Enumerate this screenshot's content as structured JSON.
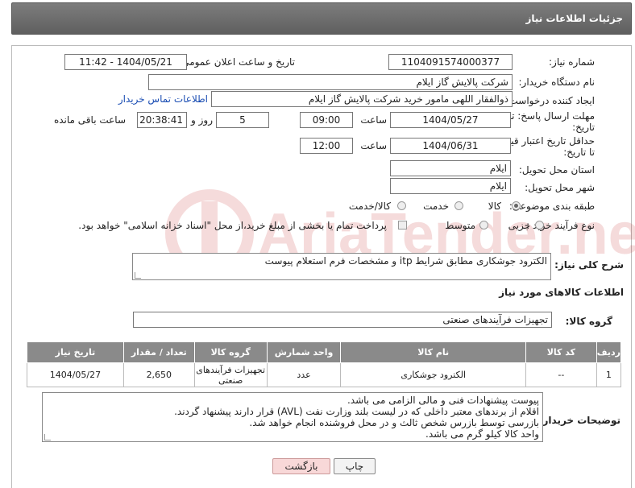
{
  "header": {
    "title": "جزئیات اطلاعات نیاز"
  },
  "form": {
    "need_number_label": "شماره نیاز:",
    "need_number": "1104091574000377",
    "announce_label": "تاریخ و ساعت اعلان عمومی:",
    "announce_value": "1404/05/21 - 11:42",
    "buyer_org_label": "نام دستگاه خریدار:",
    "buyer_org": "شرکت پالایش گاز ایلام",
    "creator_label": "ایجاد کننده درخواست:",
    "creator": "ذوالفقار اللهی مامور خرید شرکت پالایش گاز ایلام",
    "contact_link": "اطلاعات تماس خریدار",
    "reply_deadline_label_1": "مهلت ارسال پاسخ: تا",
    "reply_deadline_label_2": "تاریخ:",
    "reply_date": "1404/05/27",
    "time_label": "ساعت",
    "reply_time": "09:00",
    "days_value": "5",
    "days_label": "روز و",
    "remaining_time": "20:38:41",
    "remaining_label": "ساعت باقی مانده",
    "price_deadline_label_1": "حداقل تاریخ اعتبار قیمت:",
    "price_deadline_label_2": "تا تاریخ:",
    "price_date": "1404/06/31",
    "price_time": "12:00",
    "province_label": "استان محل تحویل:",
    "province": "ایلام",
    "city_label": "شهر محل تحویل:",
    "city": "ایلام",
    "category_label": "طبقه بندی موضوعی:",
    "category_options": [
      "کالا",
      "خدمت",
      "کالا/خدمت"
    ],
    "category_selected": "کالا",
    "process_label": "نوع فرآیند خرید :",
    "process_options": [
      "جزیی",
      "متوسط"
    ],
    "process_selected": "",
    "payment_note": "پرداخت تمام یا بخشی از مبلغ خرید،از محل \"اسناد خزانه اسلامی\" خواهد بود."
  },
  "description": {
    "label": "شرح کلی نیاز:",
    "text": "الکترود جوشکاری مطابق شرایط itp و مشخصات فرم استعلام پیوست"
  },
  "goods": {
    "section_title": "اطلاعات کالاهای مورد نیاز",
    "group_label": "گروه کالا:",
    "group_value": "تجهیزات فرآیندهای صنعتی",
    "columns": [
      "ردیف",
      "کد کالا",
      "نام کالا",
      "واحد شمارش",
      "گروه کالا",
      "تعداد / مقدار",
      "تاریخ نیاز"
    ],
    "rows": [
      {
        "row": "1",
        "code": "--",
        "name": "الکترود جوشکاری",
        "unit": "عدد",
        "group": "تجهیزات فرآیندهای صنعتی",
        "qty": "2,650",
        "date": "1404/05/27"
      }
    ]
  },
  "buyer_notes": {
    "label": "توضیحات خریدار:",
    "lines": [
      "پیوست پیشنهادات فنی و مالی الزامی می باشد.",
      "اقلام از برندهای معتبر داخلی که در لیست بلند وزارت نفت (AVL) قرار دارند پیشنهاد گردند.",
      "بازرسی توسط بازرس شخص ثالث و در محل فروشنده انجام خواهد شد.",
      "واحد کالا کیلو گرم می باشد."
    ]
  },
  "buttons": {
    "print": "چاپ",
    "back": "بازگشت"
  },
  "colors": {
    "header_bg": "#6e6e6e",
    "table_header_bg": "#8a8a8a",
    "link": "#1a4db3",
    "back_button": "#f8d8d8"
  }
}
